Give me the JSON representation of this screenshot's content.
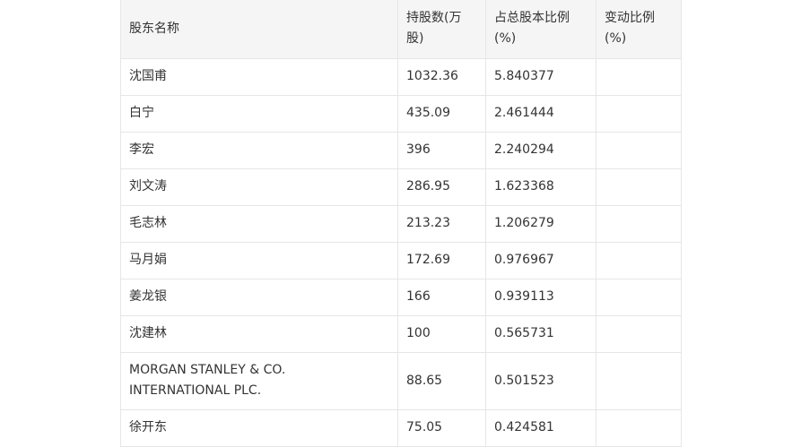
{
  "table": {
    "headers": [
      "股东名称",
      "持股数(万股)",
      "占总股本比例(%)",
      "变动比例(%)"
    ],
    "rows": [
      {
        "name": "沈国甫",
        "shares": "1032.36",
        "ratio": "5.840377",
        "change": ""
      },
      {
        "name": "白宁",
        "shares": "435.09",
        "ratio": "2.461444",
        "change": ""
      },
      {
        "name": "李宏",
        "shares": "396",
        "ratio": "2.240294",
        "change": ""
      },
      {
        "name": "刘文涛",
        "shares": "286.95",
        "ratio": "1.623368",
        "change": ""
      },
      {
        "name": "毛志林",
        "shares": "213.23",
        "ratio": "1.206279",
        "change": ""
      },
      {
        "name": "马月娟",
        "shares": "172.69",
        "ratio": "0.976967",
        "change": ""
      },
      {
        "name": "姜龙银",
        "shares": "166",
        "ratio": "0.939113",
        "change": ""
      },
      {
        "name": "沈建林",
        "shares": "100",
        "ratio": "0.565731",
        "change": ""
      },
      {
        "name": "MORGAN STANLEY & CO. INTERNATIONAL PLC.",
        "shares": "88.65",
        "ratio": "0.501523",
        "change": ""
      },
      {
        "name": "徐开东",
        "shares": "75.05",
        "ratio": "0.424581",
        "change": ""
      }
    ]
  }
}
